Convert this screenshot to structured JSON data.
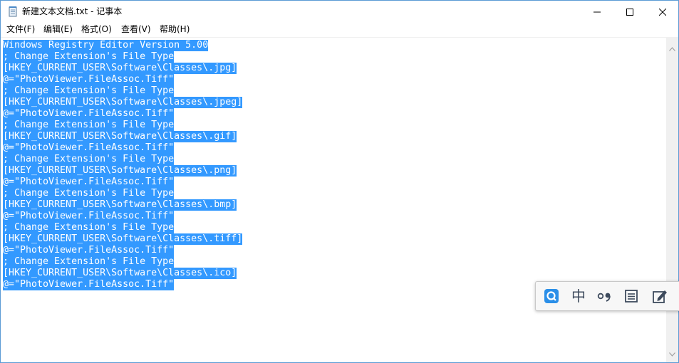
{
  "window": {
    "title": "新建文本文档.txt - 记事本",
    "icon": "notepad-icon",
    "controls": [
      "minimize-icon",
      "maximize-icon",
      "close-icon"
    ]
  },
  "menu": {
    "items": [
      {
        "label": "文件(F)"
      },
      {
        "label": "编辑(E)"
      },
      {
        "label": "格式(O)"
      },
      {
        "label": "查看(V)"
      },
      {
        "label": "帮助(H)"
      }
    ]
  },
  "editor": {
    "selection_color": "#3399ff",
    "lines": [
      "Windows Registry Editor Version 5.00",
      "; Change Extension's File Type",
      "[HKEY_CURRENT_USER\\Software\\Classes\\.jpg]",
      "@=\"PhotoViewer.FileAssoc.Tiff\"",
      "; Change Extension's File Type",
      "[HKEY_CURRENT_USER\\Software\\Classes\\.jpeg]",
      "@=\"PhotoViewer.FileAssoc.Tiff\"",
      "; Change Extension's File Type",
      "[HKEY_CURRENT_USER\\Software\\Classes\\.gif]",
      "@=\"PhotoViewer.FileAssoc.Tiff\"",
      "; Change Extension's File Type",
      "[HKEY_CURRENT_USER\\Software\\Classes\\.png]",
      "@=\"PhotoViewer.FileAssoc.Tiff\"",
      "; Change Extension's File Type",
      "[HKEY_CURRENT_USER\\Software\\Classes\\.bmp]",
      "@=\"PhotoViewer.FileAssoc.Tiff\"",
      "; Change Extension's File Type",
      "[HKEY_CURRENT_USER\\Software\\Classes\\.tiff]",
      "@=\"PhotoViewer.FileAssoc.Tiff\"",
      "; Change Extension's File Type",
      "[HKEY_CURRENT_USER\\Software\\Classes\\.ico]",
      "@=\"PhotoViewer.FileAssoc.Tiff\""
    ]
  },
  "ime_toolbar": {
    "mode_label": "中",
    "icons": [
      "search-logo-icon",
      "ime-mode-icon",
      "punctuation-icon",
      "keyboard-icon",
      "handwriting-icon"
    ]
  }
}
